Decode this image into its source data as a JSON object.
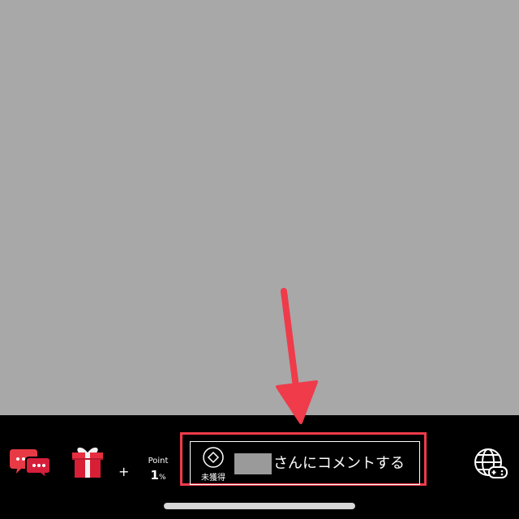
{
  "app": {
    "background_color": "#a8a8a8",
    "bar_color": "#000000",
    "accent_color": "#ef3b4a"
  },
  "toolbar": {
    "chat_icon": "chat-bubbles-icon",
    "gift_icon": "gift-box-icon",
    "plus_label": "+",
    "point_label": "Point",
    "point_value": "1",
    "point_unit": "%",
    "globe_icon": "globe-gamepad-icon"
  },
  "comment": {
    "badge_icon": "diamond-outline-icon",
    "badge_label": "未獲得",
    "placeholder": "さんにコメントする"
  },
  "annotation": {
    "arrow_icon": "red-arrow-icon",
    "highlight_color": "#ef3b4a"
  }
}
